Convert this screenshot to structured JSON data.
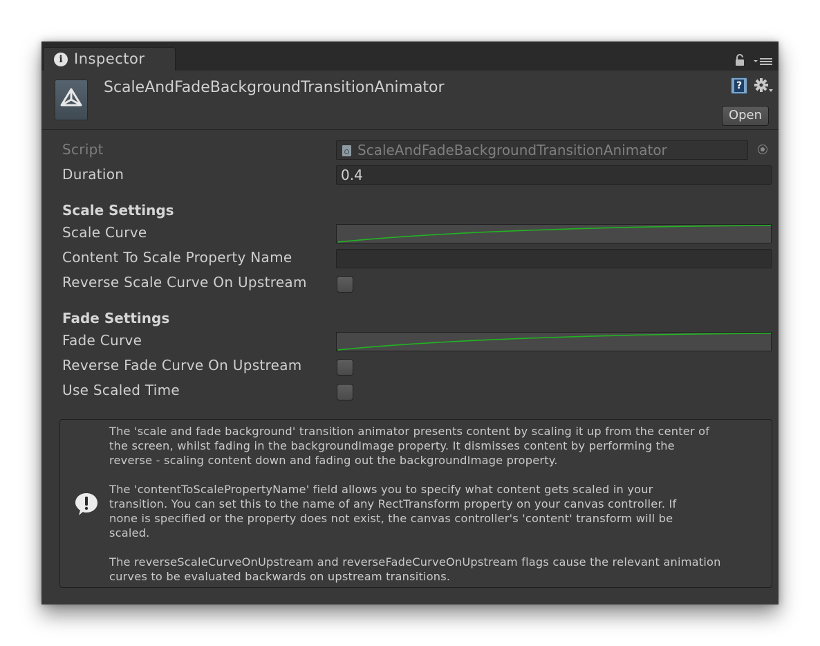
{
  "tab": {
    "label": "Inspector"
  },
  "header": {
    "title": "ScaleAndFadeBackgroundTransitionAnimator",
    "open_label": "Open"
  },
  "fields": {
    "script": {
      "label": "Script",
      "value": "ScaleAndFadeBackgroundTransitionAnimator"
    },
    "duration": {
      "label": "Duration",
      "value": "0.4"
    },
    "scale_section": "Scale Settings",
    "scale_curve": {
      "label": "Scale Curve"
    },
    "content_to_scale": {
      "label": "Content To Scale Property Name",
      "value": ""
    },
    "reverse_scale": {
      "label": "Reverse Scale Curve On Upstream",
      "checked": false
    },
    "fade_section": "Fade Settings",
    "fade_curve": {
      "label": "Fade Curve"
    },
    "reverse_fade": {
      "label": "Reverse Fade Curve On Upstream",
      "checked": false
    },
    "use_scaled_time": {
      "label": "Use Scaled Time",
      "checked": false
    }
  },
  "help": {
    "line_1": "The 'scale and fade background' transition animator presents content by scaling it up from the center of",
    "line_2": "the screen, whilst fading in the backgroundImage property. It dismisses content by performing the",
    "line_3": "reverse - scaling content down and fading out the backgroundImage property.",
    "line_4": "The 'contentToScalePropertyName' field allows you to specify what content gets scaled in your",
    "line_5": "transition. You can set this to the name of any RectTransform property on your canvas controller. If",
    "line_6": "none is specified or the property does not exist, the canvas controller's 'content' transform will be",
    "line_7": "scaled.",
    "line_8": "The reverseScaleCurveOnUpstream and reverseFadeCurveOnUpstream flags cause the relevant animation",
    "line_9": "curves to be evaluated backwards on upstream transitions."
  },
  "icons": {
    "tab": "info-icon",
    "lock": "lock-icon",
    "menu": "menu-icon",
    "asset": "unity-logo-icon",
    "help": "help-book-icon",
    "gear": "gear-icon",
    "script_file": "script-file-icon",
    "picker": "object-picker-icon",
    "helpbox": "info-icon"
  },
  "colors": {
    "panel_bg": "#383838",
    "titlebar_bg": "#2a2a2a",
    "curve_line": "#22b322",
    "text": "#cfcfcf"
  }
}
